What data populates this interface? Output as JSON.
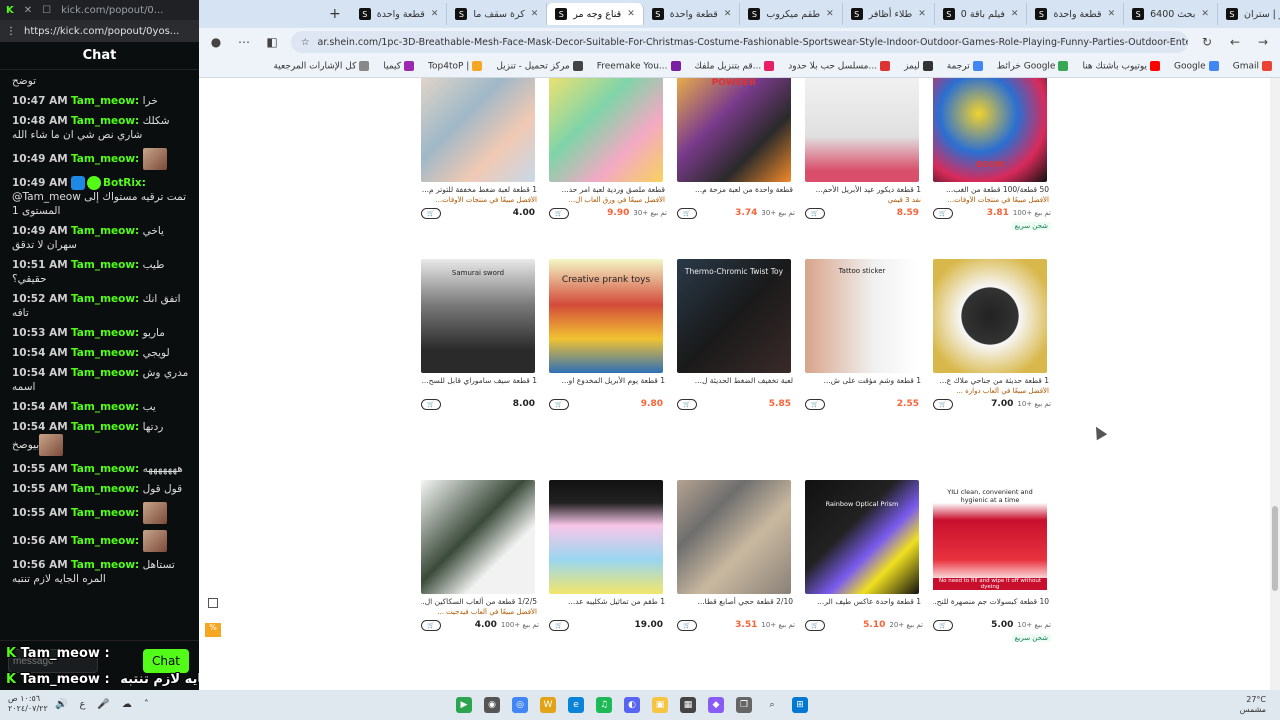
{
  "chat_panel": {
    "window_title": "kick.com/popout/0...",
    "url": "https://kick.com/popout/0yos...",
    "header": "Chat",
    "messages": [
      {
        "time": "",
        "user": "",
        "text": "توضح"
      },
      {
        "time": "10:47 AM",
        "user": "Tam_meow:",
        "text": "خرا"
      },
      {
        "time": "10:48 AM",
        "user": "Tam_meow:",
        "text": "شكلك شاري نص شي ان ما شاء الله"
      },
      {
        "time": "10:49 AM",
        "user": "Tam_meow:",
        "text": "",
        "emote": true
      },
      {
        "time": "10:49 AM",
        "user": "BotRix:",
        "text": "@Tam_meow تمت ترقيه مستواك إلى المستوى 1",
        "bot": true
      },
      {
        "time": "10:49 AM",
        "user": "Tam_meow:",
        "text": "ياخي سهران لا تدقق"
      },
      {
        "time": "10:51 AM",
        "user": "Tam_meow:",
        "text": "طيب حقيقي؟"
      },
      {
        "time": "10:52 AM",
        "user": "Tam_meow:",
        "text": "اتفق انك تافه"
      },
      {
        "time": "10:53 AM",
        "user": "Tam_meow:",
        "text": "ماريو"
      },
      {
        "time": "10:54 AM",
        "user": "Tam_meow:",
        "text": "لويجي"
      },
      {
        "time": "10:54 AM",
        "user": "Tam_meow:",
        "text": "مدري وش اسمه"
      },
      {
        "time": "10:54 AM",
        "user": "Tam_meow:",
        "text": "يب"
      },
      {
        "time": "10:54 AM",
        "user": "Tam_meow:",
        "text": "ردتها بيوصخ",
        "emote": true
      },
      {
        "time": "10:55 AM",
        "user": "Tam_meow:",
        "text": "هههههههه"
      },
      {
        "time": "10:55 AM",
        "user": "Tam_meow:",
        "text": "قول قول"
      },
      {
        "time": "10:55 AM",
        "user": "Tam_meow:",
        "text": "",
        "emote": true
      },
      {
        "time": "10:56 AM",
        "user": "Tam_meow:",
        "text": "",
        "emote": true
      },
      {
        "time": "10:56 AM",
        "user": "Tam_meow:",
        "text": "تستاهل المره الجايه لازم تنتبه"
      }
    ],
    "input_placeholder": "message",
    "send_label": "Chat"
  },
  "overlay": {
    "line1_user": "Tam_meow :",
    "line2_user": "Tam_meow :",
    "line2_text": "تستاهل المره الجايه لازم تنتبه"
  },
  "browser": {
    "tabs": [
      {
        "label": "جيتر | ستران"
      },
      {
        "label": "بحث 6400"
      },
      {
        "label": "قطعة واحدة"
      },
      {
        "label": "فيلم باقة 0"
      },
      {
        "label": "طلاء أظافر"
      },
      {
        "label": "طقم ميكروب"
      },
      {
        "label": "قطعة واحدة"
      },
      {
        "label": "قناع وجه مر",
        "active": true
      },
      {
        "label": "كرة سقف ما"
      },
      {
        "label": "قطعة واحدة"
      }
    ],
    "url": "ar.shein.com/1pc-3D-Breathable-Mesh-Face-Mask-Decor-Suitable-For-Christmas-Costume-Fashionable-Sportswear-Style-Indoor-Outdoor-Games-Role-Playing-Funny-Parties-Outdoor-Entertainment...",
    "bookmarks": [
      "Gmail",
      "Google",
      "يوتيوب باشتك هنا",
      "خرائط Google",
      "ترجمة",
      "ليمز",
      "مسلسل حب بلا حدود...",
      "قم بتنزيل ملفك...",
      "Freemake You...",
      "مركز تحميل - تنزيل",
      "Top4toP |",
      "كيميا",
      "كل الإشارات المرجعية"
    ]
  },
  "products": [
    {
      "title": "1 قطعة لعبة ضغط مخففة للتوتر م...",
      "tag": "الأفضل مبيعًا في منتجات الأوقات...",
      "price": "4.00",
      "extra": "",
      "sold": "",
      "sale": false
    },
    {
      "title": "قطعة ملصق وردية لعبة امر حد...",
      "tag": "الأفضل مبيعًا في ورق ألعاب ال...",
      "price": "9.90",
      "extra": "تم بيع +30",
      "sold": "",
      "sale": true
    },
    {
      "title": "قطعة واحدة من لعبة مزحة م...",
      "tag": "",
      "price": "3.74",
      "extra": "تم بيع +30",
      "sold": "",
      "sale": true
    },
    {
      "title": "1 قطعة ديكور عيد الأبريل الأحم...",
      "tag": "نفد 3 قيمي",
      "price": "8.59",
      "extra": "",
      "sold": "",
      "sale": true
    },
    {
      "title": "50 قطعة/100 قطعة من الغب...",
      "tag": "الأفضل مبيعًا في منتجات الأوقات...",
      "price": "3.81",
      "extra": "تم بيع +100",
      "sold": "شحن سريع",
      "sale": true
    },
    {
      "title": "1 قطعة سيف ساموراي قابل للسح...",
      "tag": "",
      "price": "8.00",
      "extra": "",
      "sold": "",
      "sale": false
    },
    {
      "title": "1 قطعة يوم الأبريل المخدوع او...",
      "tag": "",
      "price": "9.80",
      "extra": "",
      "sold": "",
      "sale": true
    },
    {
      "title": "لعبة تخفيف الضغط الحديثة ل...",
      "tag": "",
      "price": "5.85",
      "extra": "",
      "sold": "",
      "sale": true
    },
    {
      "title": "1 قطعة وشم مؤقت على ش...",
      "tag": "",
      "price": "2.55",
      "extra": "",
      "sold": "",
      "sale": true
    },
    {
      "title": "1 قطعة حديثة من جناحي ملاك ع...",
      "tag": "الأفضل مبيعًا في ألعاب دوارة ...",
      "price": "7.00",
      "extra": "تم بيع +10",
      "sold": "",
      "sale": false
    },
    {
      "title": "1/2/5 قطعة من ألعاب السكاكين ال...",
      "tag": "الأفضل مبيعًا في ألعاب فيدجيت ...",
      "price": "4.00",
      "extra": "تم بيع +100",
      "sold": "",
      "sale": false
    },
    {
      "title": "1 طقم من تماثيل شكليبه عد...",
      "tag": "",
      "price": "19.00",
      "extra": "",
      "sold": "",
      "sale": false
    },
    {
      "title": "2/10 قطعة حجي أصابع قطا...",
      "tag": "",
      "price": "3.51",
      "extra": "تم بيع +10",
      "sold": "",
      "sale": true
    },
    {
      "title": "1 قطعة واحدة عاكس طيف الر...",
      "tag": "",
      "price": "5.10",
      "extra": "تم بيع +20",
      "sold": "",
      "sale": true
    },
    {
      "title": "10 قطعة كبسولات جم منصهرة للنح...",
      "tag": "",
      "price": "5.00",
      "extra": "تم بيع +10",
      "sold": "شحن سريع",
      "sale": false
    }
  ],
  "image_labels": {
    "creative_prank": "Creative prank toys",
    "thermo": "Thermo-Chromic Twist Toy",
    "tattoo": "Tattoo sticker",
    "samurai": "Samurai sword",
    "rainbow": "Rainbow Optical Prism",
    "yili": "YILI clean, convenient and hygienic at a time",
    "yili_bottom": "No need to fill and wipe it off without dyeing",
    "powder": "POWDER",
    "boom": "BOOM"
  },
  "taskbar": {
    "date": "٢٠٢٤/٠٧/٢٢",
    "time": "١٠:٥٦ ص",
    "weather": "27°C",
    "weather_desc": "مشمس"
  },
  "colors": {
    "kick_green": "#53fc18",
    "sale_orange": "#fa6338"
  }
}
